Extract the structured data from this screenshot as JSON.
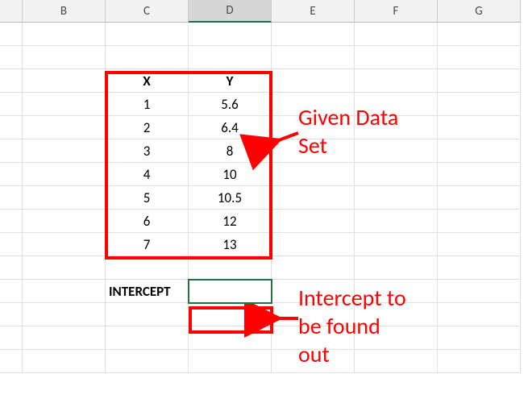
{
  "columns": [
    "B",
    "C",
    "D",
    "E",
    "F",
    "G"
  ],
  "table": {
    "header_x": "X",
    "header_y": "Y",
    "rows": [
      {
        "x": "1",
        "y": "5.6"
      },
      {
        "x": "2",
        "y": "6.4"
      },
      {
        "x": "3",
        "y": "8"
      },
      {
        "x": "4",
        "y": "10"
      },
      {
        "x": "5",
        "y": "10.5"
      },
      {
        "x": "6",
        "y": "12"
      },
      {
        "x": "7",
        "y": "13"
      }
    ]
  },
  "intercept_label": "INTERCEPT",
  "annotations": {
    "data_set_l1": "Given Data",
    "data_set_l2": "Set",
    "intercept_l1": "Intercept to",
    "intercept_l2": "be found",
    "intercept_l3": "out"
  },
  "chart_data": {
    "type": "table",
    "title": "Given Data Set",
    "columns": [
      "X",
      "Y"
    ],
    "series": [
      {
        "name": "X",
        "values": [
          1,
          2,
          3,
          4,
          5,
          6,
          7
        ]
      },
      {
        "name": "Y",
        "values": [
          5.6,
          6.4,
          8,
          10,
          10.5,
          12,
          13
        ]
      }
    ],
    "note": "Intercept to be found out"
  }
}
